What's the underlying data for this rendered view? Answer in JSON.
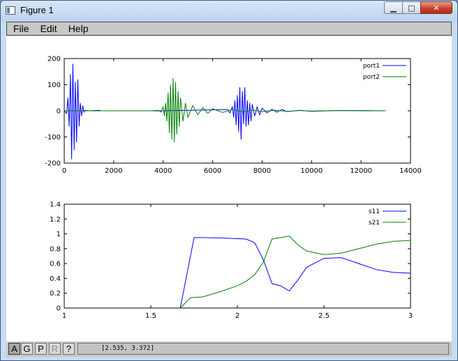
{
  "window": {
    "title": "Figure 1",
    "minimize_icon": "minimize-icon",
    "maximize_icon": "maximize-icon",
    "close_icon": "close-icon"
  },
  "caption_buttons": {
    "minimize": "▁",
    "maximize": "□",
    "close": "✕"
  },
  "menu": [
    {
      "label": "File"
    },
    {
      "label": "Edit"
    },
    {
      "label": "Help"
    }
  ],
  "toolbar": {
    "buttons": [
      {
        "label": "A",
        "state": "active"
      },
      {
        "label": "G",
        "state": "normal"
      },
      {
        "label": "P",
        "state": "normal"
      },
      {
        "label": "R",
        "state": "disabled"
      },
      {
        "label": "?",
        "state": "normal"
      }
    ],
    "coordinate_readout": "[2.535, 3.372]"
  },
  "colors": {
    "series1": "#0000ff",
    "series2": "#007f00"
  },
  "chart_data": [
    {
      "type": "line",
      "xlim": [
        0,
        14000
      ],
      "ylim": [
        -200,
        200
      ],
      "xticks": [
        0,
        2000,
        4000,
        6000,
        8000,
        10000,
        12000,
        14000
      ],
      "yticks": [
        -200,
        -100,
        0,
        100,
        200
      ],
      "legend_position": "top-right",
      "series": [
        {
          "name": "port1",
          "color": "#0000ff",
          "x": [
            0,
            100,
            150,
            200,
            250,
            300,
            350,
            400,
            450,
            500,
            550,
            600,
            650,
            700,
            750,
            800,
            850,
            1000,
            1400,
            1500,
            2000,
            4000,
            6600,
            6700,
            6800,
            6850,
            6900,
            6950,
            7000,
            7050,
            7100,
            7150,
            7200,
            7250,
            7300,
            7350,
            7400,
            7450,
            7500,
            7550,
            7600,
            7700,
            7800,
            7900,
            8000,
            8200,
            8400,
            8600,
            8800,
            9000,
            9500,
            10000,
            11000,
            12000,
            13000
          ],
          "y": [
            0,
            -10,
            50,
            -60,
            140,
            -185,
            180,
            -150,
            110,
            -120,
            120,
            -60,
            30,
            -20,
            20,
            -5,
            2,
            0,
            2,
            0,
            0,
            0,
            5,
            -8,
            15,
            -25,
            40,
            -55,
            60,
            -80,
            90,
            -110,
            75,
            -50,
            90,
            -60,
            40,
            -55,
            30,
            -40,
            25,
            -20,
            15,
            -15,
            10,
            -8,
            6,
            -5,
            5,
            -3,
            2,
            -2,
            1,
            1,
            0
          ]
        },
        {
          "name": "port2",
          "color": "#007f00",
          "x": [
            0,
            3500,
            3800,
            3900,
            4000,
            4050,
            4100,
            4150,
            4200,
            4250,
            4300,
            4350,
            4400,
            4450,
            4500,
            4550,
            4600,
            4650,
            4700,
            4800,
            4900,
            5000,
            5200,
            5400,
            5600,
            5800,
            6000,
            6400,
            6800,
            7200,
            7600,
            8000,
            8500,
            9000,
            9500,
            10000,
            11000,
            12000,
            13000
          ],
          "y": [
            0,
            0,
            2,
            -5,
            15,
            -20,
            30,
            -40,
            70,
            -85,
            100,
            -110,
            125,
            -120,
            110,
            -90,
            75,
            -60,
            50,
            -40,
            30,
            -25,
            20,
            -15,
            12,
            -10,
            8,
            -6,
            5,
            -4,
            3,
            -3,
            2,
            -2,
            1,
            -1,
            1,
            0,
            0
          ]
        }
      ]
    },
    {
      "type": "line",
      "xlim": [
        1,
        3
      ],
      "ylim": [
        0,
        1.4
      ],
      "xticks": [
        1,
        1.5,
        2,
        2.5,
        3
      ],
      "yticks": [
        0,
        0.2,
        0.4,
        0.6,
        0.8,
        1,
        1.2,
        1.4
      ],
      "legend_position": "top-right",
      "series": [
        {
          "name": "s11",
          "color": "#0000ff",
          "x": [
            1.67,
            1.75,
            1.8,
            1.9,
            2.0,
            2.05,
            2.1,
            2.15,
            2.2,
            2.25,
            2.3,
            2.35,
            2.4,
            2.5,
            2.6,
            2.7,
            2.8,
            2.9,
            3.0
          ],
          "y": [
            0,
            0.95,
            0.95,
            0.945,
            0.935,
            0.93,
            0.88,
            0.65,
            0.33,
            0.3,
            0.23,
            0.38,
            0.55,
            0.67,
            0.68,
            0.6,
            0.52,
            0.48,
            0.47
          ]
        },
        {
          "name": "s21",
          "color": "#007f00",
          "x": [
            1.67,
            1.73,
            1.8,
            1.9,
            2.0,
            2.05,
            2.1,
            2.15,
            2.2,
            2.25,
            2.3,
            2.35,
            2.4,
            2.5,
            2.6,
            2.7,
            2.8,
            2.9,
            3.0
          ],
          "y": [
            0,
            0.14,
            0.15,
            0.22,
            0.3,
            0.36,
            0.45,
            0.62,
            0.93,
            0.95,
            0.97,
            0.85,
            0.77,
            0.72,
            0.74,
            0.8,
            0.86,
            0.9,
            0.91
          ]
        }
      ]
    }
  ]
}
